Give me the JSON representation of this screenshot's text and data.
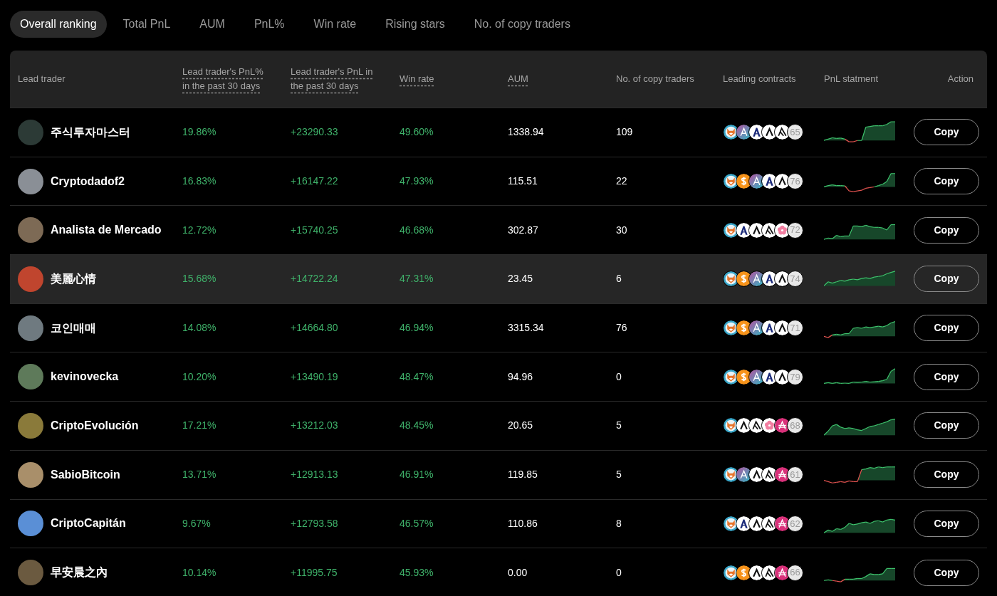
{
  "tabs": [
    {
      "label": "Overall ranking",
      "selected": true
    },
    {
      "label": "Total PnL",
      "selected": false
    },
    {
      "label": "AUM",
      "selected": false
    },
    {
      "label": "PnL%",
      "selected": false
    },
    {
      "label": "Win rate",
      "selected": false
    },
    {
      "label": "Rising stars",
      "selected": false
    },
    {
      "label": "No. of copy traders",
      "selected": false
    }
  ],
  "table": {
    "columns": [
      {
        "label": "Lead trader",
        "dashed": false
      },
      {
        "label": "Lead trader's PnL% in the past 30 days",
        "dashed": true
      },
      {
        "label": "Lead trader's PnL in the past 30 days",
        "dashed": true
      },
      {
        "label": "Win rate",
        "dashed": true
      },
      {
        "label": "AUM",
        "dashed": true
      },
      {
        "label": "No. of copy traders",
        "dashed": false
      },
      {
        "label": "Leading contracts",
        "dashed": false
      },
      {
        "label": "PnL statment",
        "dashed": false
      },
      {
        "label": "Action",
        "dashed": false
      }
    ],
    "rows": [
      {
        "name": "주식투자마스터",
        "pnl_pct": "19.86%",
        "pnl": "+23290.33",
        "win_rate": "49.60%",
        "aum": "1338.94",
        "copy_traders": "109",
        "contracts": [
          {
            "kind": "fox"
          },
          {
            "kind": "a"
          },
          {
            "kind": "h"
          },
          {
            "kind": "lambda"
          },
          {
            "kind": "arrow"
          }
        ],
        "more": "65",
        "action": "Copy",
        "highlighted": false
      },
      {
        "name": "Cryptodadof2",
        "pnl_pct": "16.83%",
        "pnl": "+16147.22",
        "win_rate": "47.93%",
        "aum": "115.51",
        "copy_traders": "22",
        "contracts": [
          {
            "kind": "fox"
          },
          {
            "kind": "dollar"
          },
          {
            "kind": "a"
          },
          {
            "kind": "h"
          },
          {
            "kind": "lambda"
          }
        ],
        "more": "76",
        "action": "Copy",
        "highlighted": false
      },
      {
        "name": "Analista de Mercado",
        "pnl_pct": "12.72%",
        "pnl": "+15740.25",
        "win_rate": "46.68%",
        "aum": "302.87",
        "copy_traders": "30",
        "contracts": [
          {
            "kind": "fox"
          },
          {
            "kind": "h"
          },
          {
            "kind": "lambda"
          },
          {
            "kind": "arrow"
          },
          {
            "kind": "flower"
          }
        ],
        "more": "72",
        "action": "Copy",
        "highlighted": false
      },
      {
        "name": "美麗心情",
        "pnl_pct": "15.68%",
        "pnl": "+14722.24",
        "win_rate": "47.31%",
        "aum": "23.45",
        "copy_traders": "6",
        "contracts": [
          {
            "kind": "fox"
          },
          {
            "kind": "dollar"
          },
          {
            "kind": "a"
          },
          {
            "kind": "h"
          },
          {
            "kind": "lambda"
          }
        ],
        "more": "74",
        "action": "Copy",
        "highlighted": true
      },
      {
        "name": "코인매매",
        "pnl_pct": "14.08%",
        "pnl": "+14664.80",
        "win_rate": "46.94%",
        "aum": "3315.34",
        "copy_traders": "76",
        "contracts": [
          {
            "kind": "fox"
          },
          {
            "kind": "dollar"
          },
          {
            "kind": "a"
          },
          {
            "kind": "h"
          },
          {
            "kind": "lambda"
          }
        ],
        "more": "71",
        "action": "Copy",
        "highlighted": false
      },
      {
        "name": "kevinovecka",
        "pnl_pct": "10.20%",
        "pnl": "+13490.19",
        "win_rate": "48.47%",
        "aum": "94.96",
        "copy_traders": "0",
        "contracts": [
          {
            "kind": "fox"
          },
          {
            "kind": "dollar"
          },
          {
            "kind": "a"
          },
          {
            "kind": "h"
          },
          {
            "kind": "lambda"
          }
        ],
        "more": "79",
        "action": "Copy",
        "highlighted": false
      },
      {
        "name": "CriptoEvolución",
        "pnl_pct": "17.21%",
        "pnl": "+13212.03",
        "win_rate": "48.45%",
        "aum": "20.65",
        "copy_traders": "5",
        "contracts": [
          {
            "kind": "fox"
          },
          {
            "kind": "lambda"
          },
          {
            "kind": "arrow"
          },
          {
            "kind": "flower"
          },
          {
            "kind": "amp"
          }
        ],
        "more": "68",
        "action": "Copy",
        "highlighted": false
      },
      {
        "name": "SabioBitcoin",
        "pnl_pct": "13.71%",
        "pnl": "+12913.13",
        "win_rate": "46.91%",
        "aum": "119.85",
        "copy_traders": "5",
        "contracts": [
          {
            "kind": "fox"
          },
          {
            "kind": "a"
          },
          {
            "kind": "lambda"
          },
          {
            "kind": "arrow"
          },
          {
            "kind": "amp"
          }
        ],
        "more": "61",
        "action": "Copy",
        "highlighted": false
      },
      {
        "name": "CriptoCapitán",
        "pnl_pct": "9.67%",
        "pnl": "+12793.58",
        "win_rate": "46.57%",
        "aum": "110.86",
        "copy_traders": "8",
        "contracts": [
          {
            "kind": "fox"
          },
          {
            "kind": "h"
          },
          {
            "kind": "lambda"
          },
          {
            "kind": "arrow"
          },
          {
            "kind": "amp"
          }
        ],
        "more": "62",
        "action": "Copy",
        "highlighted": false
      },
      {
        "name": "早安晨之內",
        "pnl_pct": "10.14%",
        "pnl": "+11995.75",
        "win_rate": "45.93%",
        "aum": "0.00",
        "copy_traders": "0",
        "contracts": [
          {
            "kind": "fox"
          },
          {
            "kind": "dollar"
          },
          {
            "kind": "lambda"
          },
          {
            "kind": "arrow"
          },
          {
            "kind": "amp"
          }
        ],
        "more": "66",
        "action": "Copy",
        "highlighted": false
      }
    ]
  }
}
